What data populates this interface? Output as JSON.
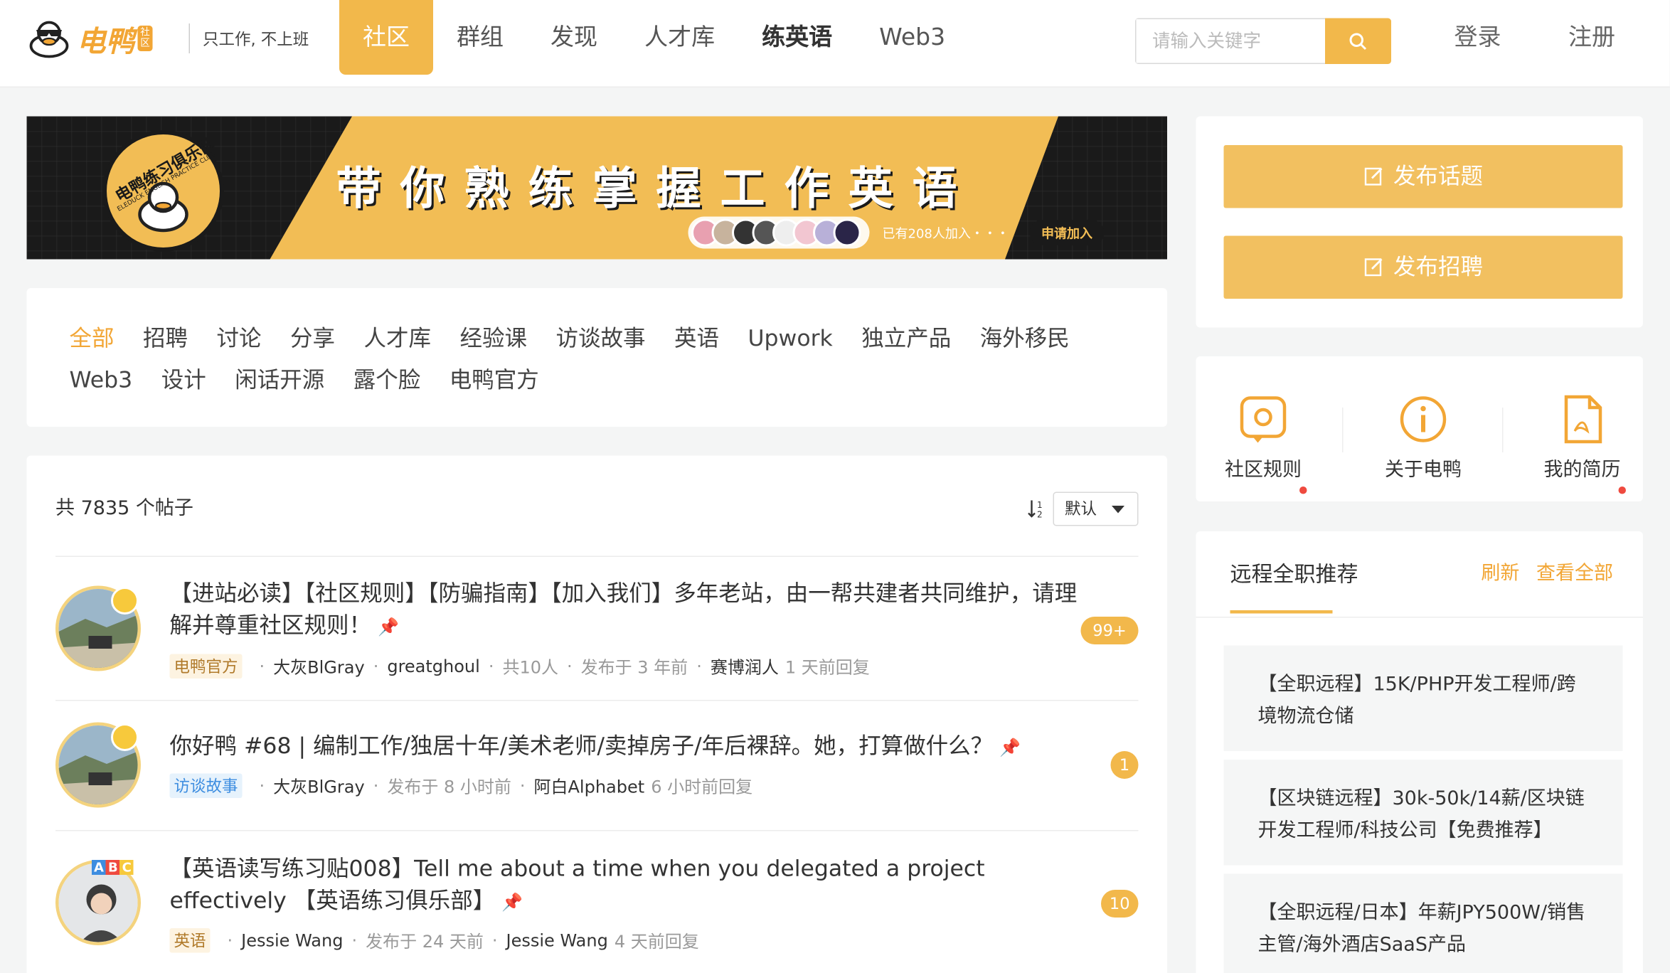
{
  "header": {
    "logo_text": "电鸭",
    "logo_tag": "社区",
    "slogan": "只工作, 不上班",
    "nav": [
      {
        "label": "社区",
        "active": true
      },
      {
        "label": "群组"
      },
      {
        "label": "发现"
      },
      {
        "label": "人才库"
      },
      {
        "label": "练英语",
        "bold": true
      },
      {
        "label": "Web3"
      }
    ],
    "search_placeholder": "请输入关键字",
    "login": "登录",
    "register": "注册"
  },
  "banner": {
    "club_text": "电鸭练习俱乐部",
    "club_sub": "ELEDUCK ENGLISH PRACTICE CLUB",
    "headline": "带你熟练掌握工作英语",
    "joined": "已有208人加入・・・",
    "apply": "申请加入"
  },
  "categories": [
    "全部",
    "招聘",
    "讨论",
    "分享",
    "人才库",
    "经验课",
    "访谈故事",
    "英语",
    "Upwork",
    "独立产品",
    "海外移民",
    "Web3",
    "设计",
    "闲话开源",
    "露个脸",
    "电鸭官方"
  ],
  "posts_header": {
    "count": "共 7835 个帖子",
    "sort": "默认"
  },
  "posts": [
    {
      "title": "【进站必读】【社区规则】【防骗指南】【加入我们】多年老站，由一帮共建者共同维护，请理解并尊重社区规则！",
      "tag": "电鸭官方",
      "author": "大灰BlGray",
      "extra": "greatghoul",
      "participants": "共10人",
      "published": "发布于 3 年前",
      "replier": "赛博润人",
      "replied": "1 天前回复",
      "count": "99+"
    },
    {
      "title": "你好鸭 #68 | 编制工作/独居十年/美术老师/卖掉房子/年后裸辞。她，打算做什么？",
      "tag": "访谈故事",
      "author": "大灰BlGray",
      "published": "发布于 8 小时前",
      "replier": "阿白Alphabet",
      "replied": "6 小时前回复",
      "count": "1"
    },
    {
      "title": "【英语读写练习贴008】Tell me about a time when you delegated a project effectively 【英语练习俱乐部】",
      "tag": "英语",
      "author": "Jessie Wang",
      "published": "发布于 24 天前",
      "replier": "Jessie Wang",
      "replied": "4 天前回复",
      "count": "10"
    }
  ],
  "sidebar": {
    "publish_topic": "发布话题",
    "publish_job": "发布招聘",
    "quick": [
      "社区规则",
      "关于电鸭",
      "我的简历"
    ],
    "remote_title": "远程全职推荐",
    "refresh": "刷新",
    "view_all": "查看全部",
    "jobs": [
      "【全职远程】15K/PHP开发工程师/跨境物流仓储",
      "【区块链远程】30k-50k/14薪/区块链开发工程师/科技公司【免费推荐】",
      "【全职远程/日本】年薪JPY500W/销售主管/海外酒店SaaS产品"
    ]
  },
  "colors": {
    "accent": "#f2b84b",
    "accent_text": "#f2a635",
    "red_dot": "#ef4a3f"
  }
}
